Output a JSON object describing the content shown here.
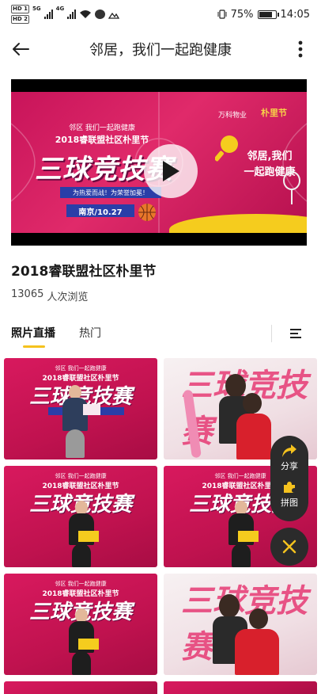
{
  "status_bar": {
    "sim1": "HD 1",
    "sim2": "HD 2",
    "net1": "5G",
    "net2": "4G",
    "battery": "75%",
    "battery_level": 0.75,
    "time": "14:05"
  },
  "header": {
    "title": "邻居，我们一起跑健康"
  },
  "video": {
    "banner_subtitle": "邻区 我们一起跑健康",
    "banner_event": "2018睿联盟社区朴里节",
    "banner_main": "三球竞技赛",
    "banner_ribbon": "为热爱而战！为荣誉加冕！",
    "banner_date": "南京/10.27",
    "banner_slogan_1": "邻居,我们",
    "banner_slogan_2": "一起跑健康",
    "banner_brand": "万科物业",
    "banner_brand2": "朴里节"
  },
  "event": {
    "title": "2018睿联盟社区朴里节",
    "views_count": "13065",
    "views_label": "人次浏览"
  },
  "tabs": [
    {
      "label": "照片直播",
      "active": true
    },
    {
      "label": "热门",
      "active": false
    }
  ],
  "photo_text": {
    "subtitle": "邻区 我们一起跑健康",
    "event": "2018睿联盟社区朴里节",
    "main": "三球竞技赛"
  },
  "fab": {
    "share_label": "分享",
    "collage_label": "拼图"
  },
  "colors": {
    "accent": "#f5c21e",
    "banner_red": "#d8195e",
    "fab_bg": "#2b2b2b"
  }
}
